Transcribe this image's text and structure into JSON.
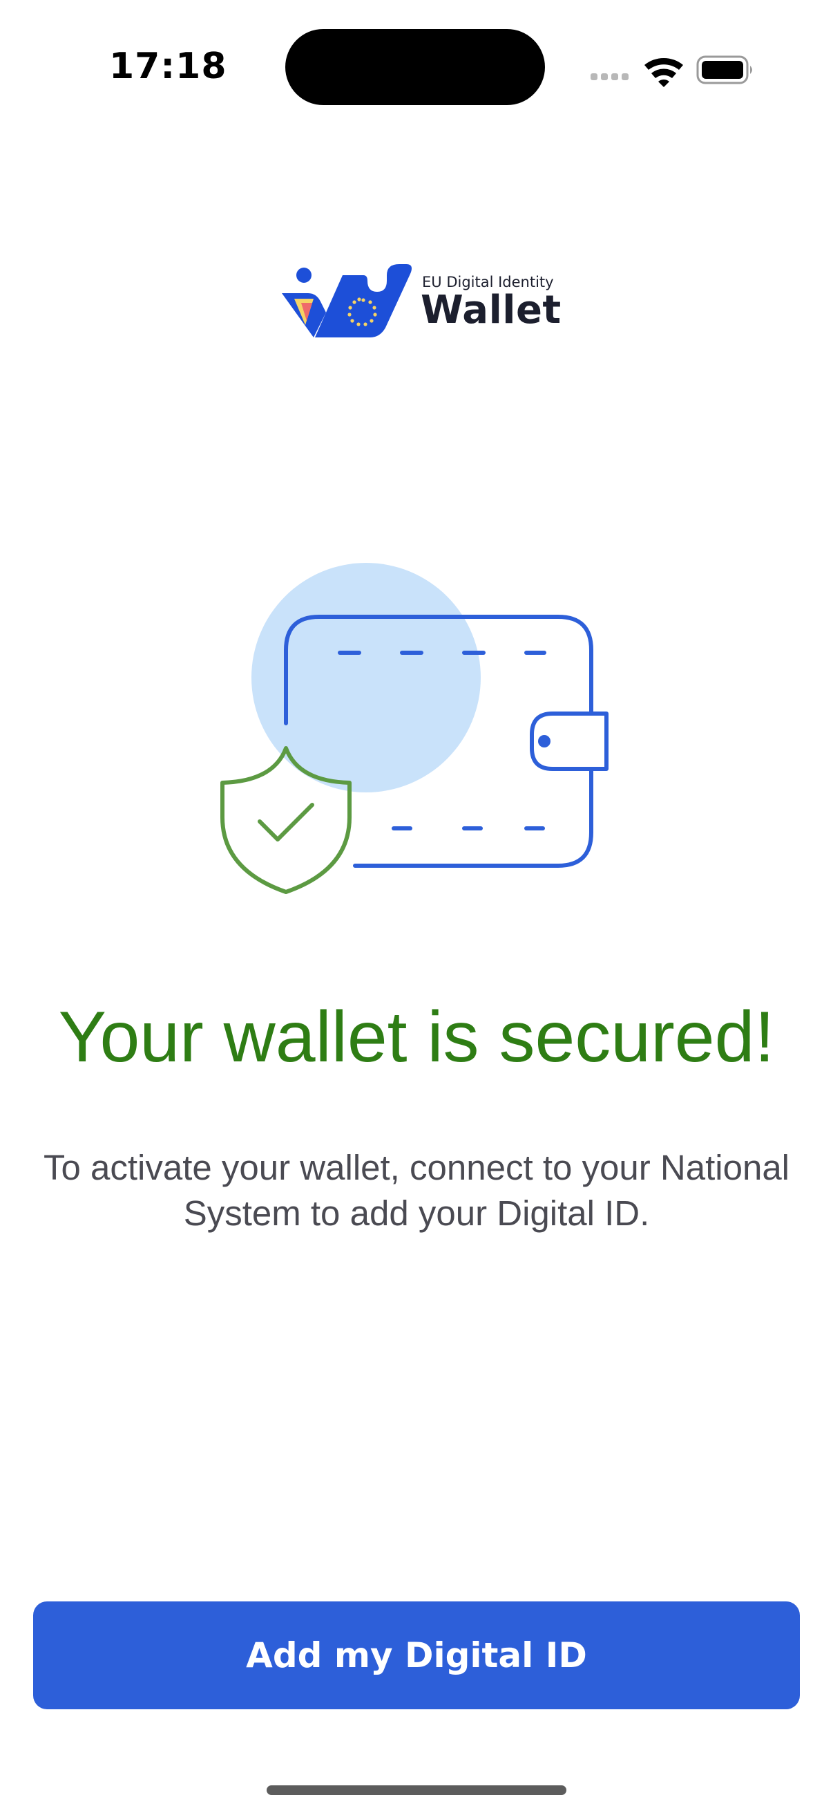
{
  "status_bar": {
    "time": "17:18",
    "signal_icon": "cellular-dots-icon",
    "wifi_icon": "wifi-icon",
    "battery_icon": "battery-full-icon"
  },
  "logo": {
    "small_text": "EU Digital Identity",
    "big_text": "Wallet",
    "icon": "eu-wallet-logo-icon"
  },
  "illustration": {
    "icon": "secured-wallet-illustration"
  },
  "headline": "Your wallet is secured!",
  "description": "To activate your wallet, connect to your National System to add your Digital ID.",
  "primary_button": {
    "label": "Add my Digital ID"
  },
  "colors": {
    "accent": "#2d5fd9",
    "success": "#2e7d14",
    "light_blue": "#c9e2fa",
    "shield_green": "#5c9a42"
  }
}
